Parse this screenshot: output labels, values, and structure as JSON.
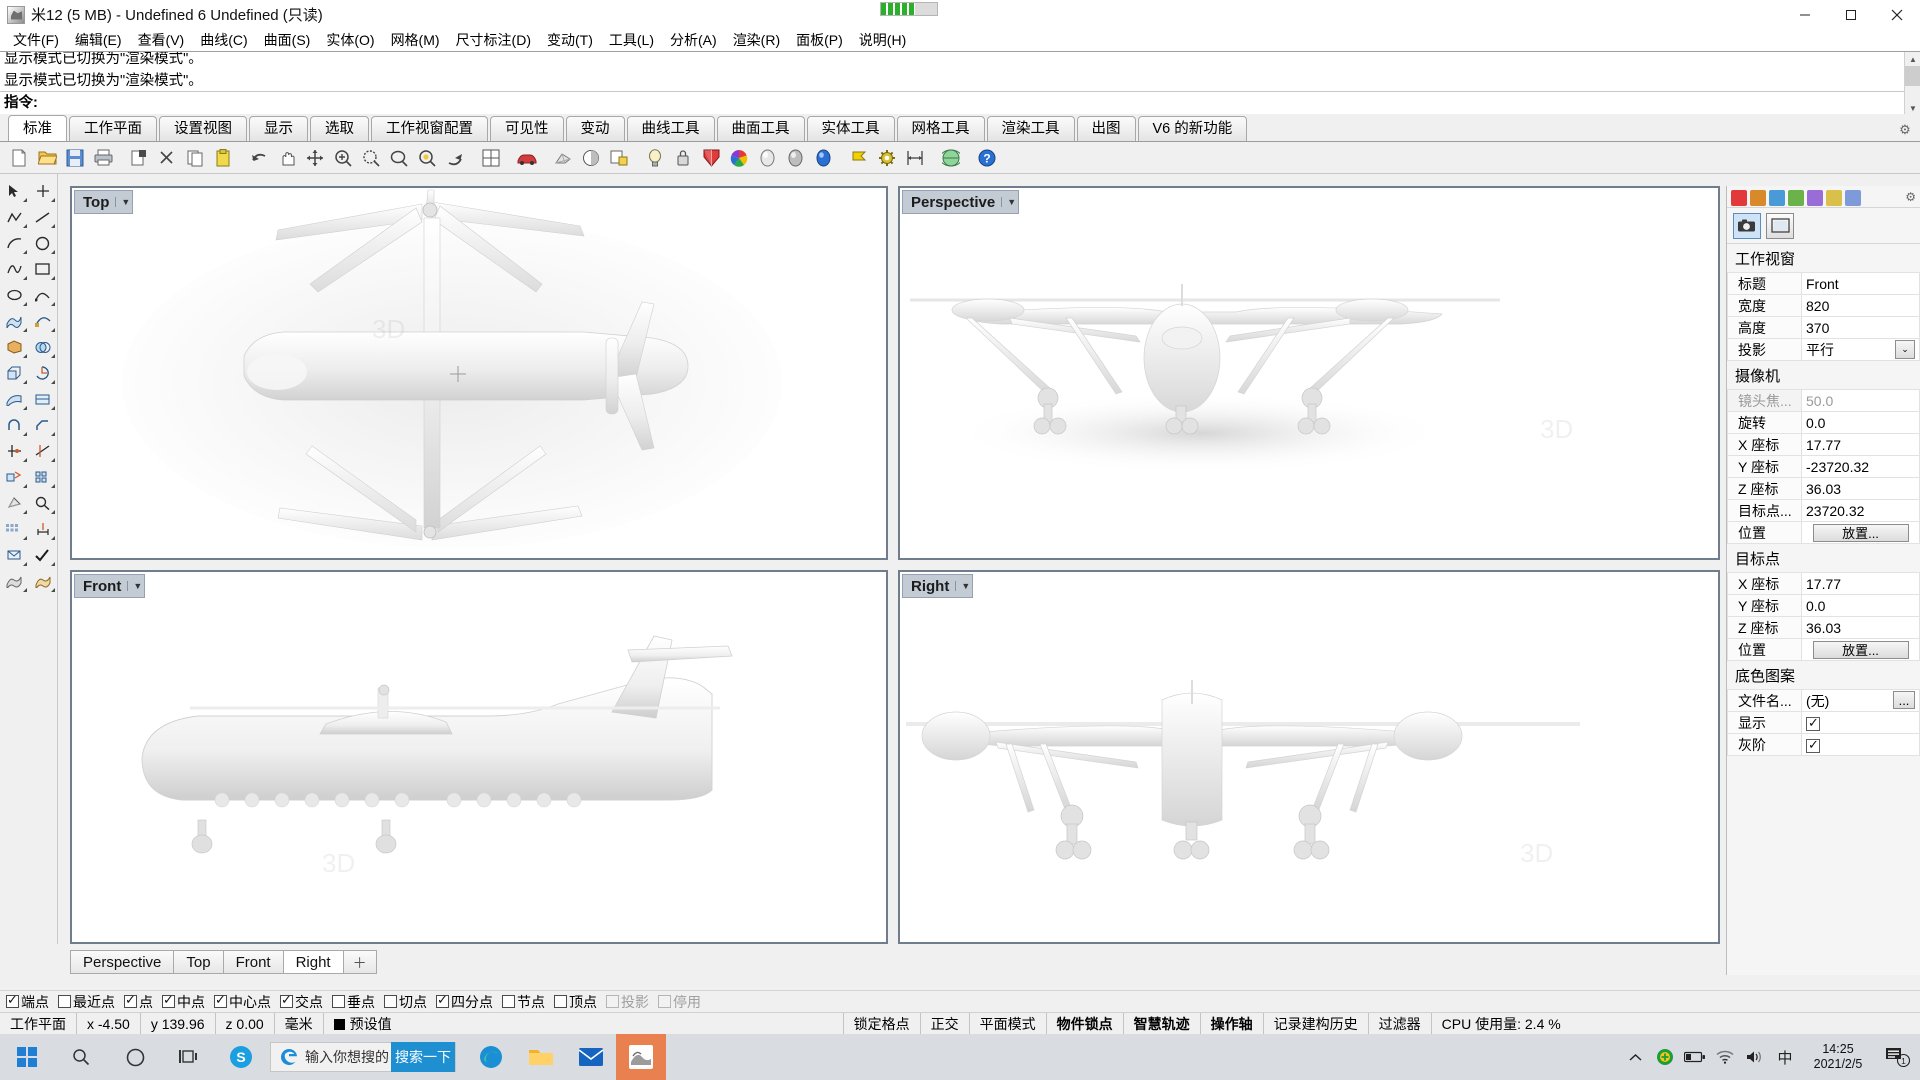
{
  "window": {
    "title": "米12 (5 MB) - Undefined 6 Undefined (只读)",
    "minimize": "–",
    "maximize": "▢",
    "close": "✕"
  },
  "menubar": {
    "items": [
      {
        "label": "文件(F)"
      },
      {
        "label": "编辑(E)"
      },
      {
        "label": "查看(V)"
      },
      {
        "label": "曲线(C)"
      },
      {
        "label": "曲面(S)"
      },
      {
        "label": "实体(O)"
      },
      {
        "label": "网格(M)"
      },
      {
        "label": "尺寸标注(D)"
      },
      {
        "label": "变动(T)"
      },
      {
        "label": "工具(L)"
      },
      {
        "label": "分析(A)"
      },
      {
        "label": "渲染(R)"
      },
      {
        "label": "面板(P)"
      },
      {
        "label": "说明(H)"
      }
    ]
  },
  "command": {
    "history_line1": "显示模式已切换为\"渲染模式\"。",
    "history_line2": "显示模式已切换为\"渲染模式\"。",
    "prompt_label": "指令:",
    "prompt_value": ""
  },
  "ribbon": {
    "tabs": [
      {
        "label": "标准",
        "active": true
      },
      {
        "label": "工作平面",
        "active": false
      },
      {
        "label": "设置视图",
        "active": false
      },
      {
        "label": "显示",
        "active": false
      },
      {
        "label": "选取",
        "active": false
      },
      {
        "label": "工作视窗配置",
        "active": false
      },
      {
        "label": "可见性",
        "active": false
      },
      {
        "label": "变动",
        "active": false
      },
      {
        "label": "曲线工具",
        "active": false
      },
      {
        "label": "曲面工具",
        "active": false
      },
      {
        "label": "实体工具",
        "active": false
      },
      {
        "label": "网格工具",
        "active": false
      },
      {
        "label": "渲染工具",
        "active": false
      },
      {
        "label": "出图",
        "active": false
      },
      {
        "label": "V6 的新功能",
        "active": false
      }
    ]
  },
  "toolbar": {
    "buttons": [
      {
        "name": "new-file-icon"
      },
      {
        "name": "open-file-icon"
      },
      {
        "name": "save-file-icon"
      },
      {
        "name": "print-icon"
      },
      {
        "name": "cut-copy-icon"
      },
      {
        "name": "scissors-icon"
      },
      {
        "name": "copy-icon"
      },
      {
        "name": "paste-icon"
      },
      {
        "name": "undo-icon"
      },
      {
        "name": "pan-icon"
      },
      {
        "name": "zoom-extents-icon"
      },
      {
        "name": "zoom-in-icon"
      },
      {
        "name": "zoom-window-icon"
      },
      {
        "name": "zoom-selected-icon"
      },
      {
        "name": "zoom-target-icon"
      },
      {
        "name": "rotate-view-icon"
      },
      {
        "name": "four-viewport-icon"
      },
      {
        "name": "render-icon"
      },
      {
        "name": "mesh-render-icon"
      },
      {
        "name": "shade-icon"
      },
      {
        "name": "properties-icon"
      },
      {
        "name": "light-bulb-icon"
      },
      {
        "name": "lock-layer-icon"
      },
      {
        "name": "material-icon"
      },
      {
        "name": "color-wheel-icon"
      },
      {
        "name": "sphere-gray-icon"
      },
      {
        "name": "sphere-shade-icon"
      },
      {
        "name": "sphere-blue-icon"
      },
      {
        "name": "flag-icon"
      },
      {
        "name": "gear-options-icon"
      },
      {
        "name": "dimension-icon"
      },
      {
        "name": "globe-icon"
      },
      {
        "name": "help-icon"
      }
    ]
  },
  "leftpalette": {
    "rows": [
      [
        {
          "name": "select-arrow-icon"
        },
        {
          "name": "point-icon"
        }
      ],
      [
        {
          "name": "polyline-icon"
        },
        {
          "name": "line-icon"
        }
      ],
      [
        {
          "name": "arc-icon"
        },
        {
          "name": "circle-icon"
        }
      ],
      [
        {
          "name": "curve-icon"
        },
        {
          "name": "rectangle-icon"
        }
      ],
      [
        {
          "name": "ellipse-icon"
        },
        {
          "name": "freeform-icon"
        }
      ],
      [
        {
          "name": "surface-icon"
        },
        {
          "name": "sweep-icon"
        }
      ],
      [
        {
          "name": "box-solid-icon"
        },
        {
          "name": "boolean-icon"
        }
      ],
      [
        {
          "name": "extrude-icon"
        },
        {
          "name": "revolve-icon"
        }
      ],
      [
        {
          "name": "loft-icon"
        },
        {
          "name": "patch-icon"
        }
      ],
      [
        {
          "name": "fillet-icon"
        },
        {
          "name": "chamfer-icon"
        }
      ],
      [
        {
          "name": "trim-icon"
        },
        {
          "name": "split-icon"
        }
      ],
      [
        {
          "name": "transform-icon"
        },
        {
          "name": "array-icon"
        }
      ],
      [
        {
          "name": "mesh-icon"
        },
        {
          "name": "analyze-icon"
        }
      ],
      [
        {
          "name": "grid-icon"
        },
        {
          "name": "measure-icon"
        }
      ],
      [
        {
          "name": "layer-icon"
        },
        {
          "name": "check-icon"
        }
      ],
      [
        {
          "name": "shade-mode-icon"
        },
        {
          "name": "render-mode-icon"
        }
      ]
    ]
  },
  "viewports": [
    {
      "key": "top",
      "label": "Top",
      "caret": "▼"
    },
    {
      "key": "persp",
      "label": "Perspective",
      "caret": "▼"
    },
    {
      "key": "front",
      "label": "Front",
      "caret": "▼"
    },
    {
      "key": "right",
      "label": "Right",
      "caret": "▼"
    }
  ],
  "viewport_tabs": {
    "items": [
      {
        "label": "Perspective",
        "active": false
      },
      {
        "label": "Top",
        "active": false
      },
      {
        "label": "Front",
        "active": false
      },
      {
        "label": "Right",
        "active": true
      }
    ],
    "add_label": "＋"
  },
  "properties": {
    "icons": [
      {
        "name": "object-properties-icon",
        "color": "#e23a3a"
      },
      {
        "name": "material-properties-icon",
        "color": "#d88a2a"
      },
      {
        "name": "light-properties-icon",
        "color": "#4a9ad8"
      },
      {
        "name": "display-properties-icon",
        "color": "#6cb24a"
      },
      {
        "name": "link-properties-icon",
        "color": "#9a6cd8"
      },
      {
        "name": "folder-properties-icon",
        "color": "#d8c04a"
      },
      {
        "name": "page-properties-icon",
        "color": "#7f9ad8"
      }
    ],
    "gear": "⚙",
    "big_buttons": [
      {
        "name": "camera-properties-tab",
        "selected": true
      },
      {
        "name": "viewport-properties-tab",
        "selected": false
      }
    ],
    "sections": [
      {
        "title": "工作视窗",
        "rows": [
          {
            "key": "标题",
            "value": "Front",
            "type": "text"
          },
          {
            "key": "宽度",
            "value": "820",
            "type": "text"
          },
          {
            "key": "高度",
            "value": "370",
            "type": "text"
          },
          {
            "key": "投影",
            "value": "平行",
            "type": "dropdown",
            "caret": "⌄"
          }
        ]
      },
      {
        "title": "摄像机",
        "rows": [
          {
            "key": "镜头焦...",
            "value": "50.0",
            "type": "text",
            "dim": true
          },
          {
            "key": "旋转",
            "value": "0.0",
            "type": "text"
          },
          {
            "key": "X 座标",
            "value": "17.77",
            "type": "text"
          },
          {
            "key": "Y 座标",
            "value": "-23720.32",
            "type": "text"
          },
          {
            "key": "Z 座标",
            "value": "36.03",
            "type": "text"
          },
          {
            "key": "目标点...",
            "value": "23720.32",
            "type": "text"
          },
          {
            "key": "位置",
            "value": "放置...",
            "type": "button"
          }
        ]
      },
      {
        "title": "目标点",
        "rows": [
          {
            "key": "X 座标",
            "value": "17.77",
            "type": "text"
          },
          {
            "key": "Y 座标",
            "value": "0.0",
            "type": "text"
          },
          {
            "key": "Z 座标",
            "value": "36.03",
            "type": "text"
          },
          {
            "key": "位置",
            "value": "放置...",
            "type": "button"
          }
        ]
      },
      {
        "title": "底色图案",
        "rows": [
          {
            "key": "文件名...",
            "value": "(无)",
            "type": "smallbutton",
            "button_label": "..."
          },
          {
            "key": "显示",
            "value": "",
            "type": "checkbox",
            "checked": true
          },
          {
            "key": "灰阶",
            "value": "",
            "type": "checkbox",
            "checked": true
          }
        ]
      }
    ]
  },
  "osnap": {
    "items": [
      {
        "label": "端点",
        "checked": true,
        "disabled": false
      },
      {
        "label": "最近点",
        "checked": false,
        "disabled": false
      },
      {
        "label": "点",
        "checked": true,
        "disabled": false
      },
      {
        "label": "中点",
        "checked": true,
        "disabled": false
      },
      {
        "label": "中心点",
        "checked": true,
        "disabled": false
      },
      {
        "label": "交点",
        "checked": true,
        "disabled": false
      },
      {
        "label": "垂点",
        "checked": false,
        "disabled": false
      },
      {
        "label": "切点",
        "checked": false,
        "disabled": false
      },
      {
        "label": "四分点",
        "checked": true,
        "disabled": false
      },
      {
        "label": "节点",
        "checked": false,
        "disabled": false
      },
      {
        "label": "顶点",
        "checked": false,
        "disabled": false
      },
      {
        "label": "投影",
        "checked": false,
        "disabled": true
      },
      {
        "label": "停用",
        "checked": false,
        "disabled": true
      }
    ]
  },
  "statusbar": {
    "left": [
      {
        "label": "工作平面",
        "bold": false
      },
      {
        "label": "x -4.50",
        "bold": false
      },
      {
        "label": "y 139.96",
        "bold": false
      },
      {
        "label": "z 0.00",
        "bold": false
      },
      {
        "label": "毫米",
        "bold": false
      }
    ],
    "layer": {
      "label": "预设值",
      "color": "#000000"
    },
    "right": [
      {
        "label": "锁定格点",
        "bold": false
      },
      {
        "label": "正交",
        "bold": false
      },
      {
        "label": "平面模式",
        "bold": false
      },
      {
        "label": "物件锁点",
        "bold": true
      },
      {
        "label": "智慧轨迹",
        "bold": true
      },
      {
        "label": "操作轴",
        "bold": true
      },
      {
        "label": "记录建构历史",
        "bold": false
      },
      {
        "label": "过滤器",
        "bold": false
      },
      {
        "label": "CPU 使用量: 2.4 %",
        "bold": false
      }
    ]
  },
  "taskbar": {
    "start": {
      "name": "start-button",
      "label": "⊞"
    },
    "search_icon": {
      "name": "taskbar-search-icon"
    },
    "cortana_icon": {
      "name": "cortana-circle-icon"
    },
    "taskview_icon": {
      "name": "task-view-icon"
    },
    "apps": [
      {
        "name": "skype-app-icon",
        "label": "S"
      },
      {
        "name": "edge-app-icon",
        "label": ""
      },
      {
        "name": "explorer-app-icon",
        "label": ""
      },
      {
        "name": "mail-app-icon",
        "label": ""
      },
      {
        "name": "rhino-app-icon",
        "label": "",
        "active": true
      }
    ],
    "searchbox": {
      "placeholder": "输入你想搜的",
      "button_label": "搜索一下"
    },
    "tray": {
      "chevron": "︿",
      "icons": [
        {
          "name": "security-shield-icon"
        },
        {
          "name": "battery-icon"
        },
        {
          "name": "wifi-icon"
        },
        {
          "name": "volume-icon"
        },
        {
          "name": "ime-icon",
          "label": "中"
        }
      ],
      "time": "14:25",
      "date": "2021/2/5",
      "notification_count": "1"
    }
  },
  "colors": {
    "accent": "#1e90d2",
    "viewport_border": "#6f7d8c",
    "viewport_label_bg": "#c3cbd4",
    "chrome_bg": "#f0f0f0",
    "taskbar_bg": "#d9dde2",
    "active_app": "#e8804f"
  }
}
